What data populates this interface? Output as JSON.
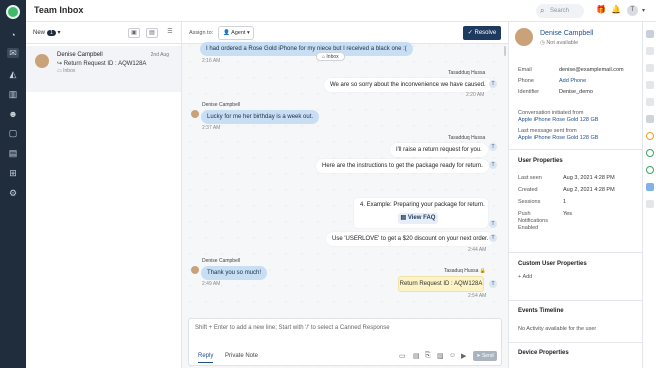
{
  "app": {
    "title": "Team Inbox"
  },
  "top": {
    "search_placeholder": "Search",
    "avatar_letter": "T"
  },
  "list": {
    "filter_label": "New",
    "filter_count": "1",
    "conversation": {
      "name": "Denise Campbell",
      "subject": "Return Request ID : AQW128A",
      "inbox": "Inbox",
      "time": "2nd Aug"
    }
  },
  "chat": {
    "assign_label": "Assign to:",
    "assignee": "Agent",
    "resolve_label": "Resolve",
    "inbox_pill": "Inbox",
    "messages": [
      {
        "text": "I had ordered a Rose Gold iPhone for my niece but I received a black one :(",
        "time": "2:16 AM"
      },
      {
        "sender": "Tasadduq Hussa",
        "text": "We are so sorry about the inconvenience we have caused.",
        "time": "2:20 AM"
      },
      {
        "sender": "Denise Campbell",
        "text": "Lucky for me her birthday is a week out.",
        "time": "2:37 AM"
      },
      {
        "sender": "Tasadduq Hussa",
        "text": "I'll raise a return request for you.",
        "time": ""
      },
      {
        "text": "Here are the instructions to get the package ready for return.",
        "time": ""
      },
      {
        "text": "4. Example: Preparing your package for return.",
        "button": "View FAQ"
      },
      {
        "text": "Use 'USERLOVE' to get a $20 discount on your next order.",
        "time": "2:44 AM"
      },
      {
        "sender": "Denise Campbell",
        "text": "Thank you so much!",
        "time": "2:49 AM"
      },
      {
        "sender": "Tasaduq Hussa",
        "text": "Return Request ID : AQW128A",
        "time": "2:54 AM"
      }
    ],
    "composer": {
      "placeholder": "Shift + Enter to add a new line; Start with '/' to select a Canned Response",
      "tab_reply": "Reply",
      "tab_private": "Private Note",
      "send": "Send"
    }
  },
  "contact": {
    "name": "Denise Campbell",
    "status": "Not available",
    "email_label": "Email",
    "email": "denise@examplemail.com",
    "phone_label": "Phone",
    "phone": "Add Phone",
    "id_label": "Identifier",
    "id": "Denise_demo",
    "initiated_label": "Conversation initiated from",
    "initiated": "Apple iPhone Rose Gold 128 GB",
    "last_msg_label": "Last message sent from",
    "last_msg": "Apple iPhone Rose Gold 128 GB",
    "user_props": "User Properties",
    "last_seen_label": "Last seen",
    "last_seen": "Aug 3, 2021 4:28 PM",
    "created_label": "Created",
    "created": "Aug 2, 2021 4:28 PM",
    "sessions_label": "Sessions",
    "sessions": "1",
    "push_label": "Push Notifications Enabled",
    "push": "Yes",
    "custom_props": "Custom User Properties",
    "add": "Add",
    "events": "Events Timeline",
    "no_activity": "No Activity available for the user",
    "device": "Device Properties"
  }
}
